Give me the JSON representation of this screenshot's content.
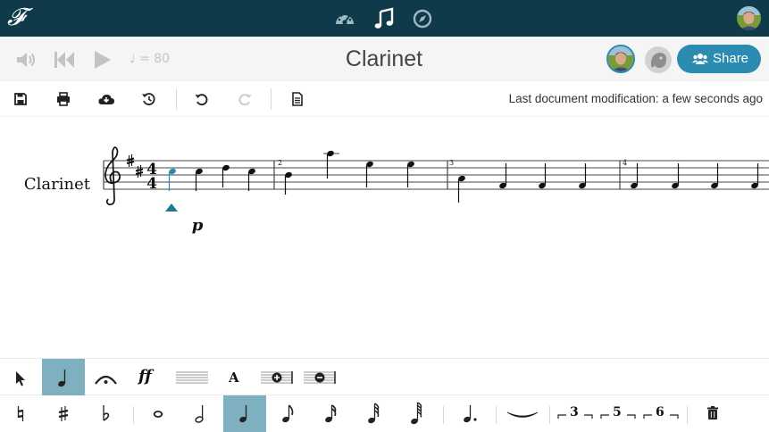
{
  "app": {
    "logo_text": "𝓕",
    "logo_icon": "flat-logo-icon"
  },
  "topnav": {
    "items": [
      {
        "name": "dashboard-icon",
        "active": false
      },
      {
        "name": "music-note-icon",
        "active": true
      },
      {
        "name": "compass-icon",
        "active": false
      }
    ]
  },
  "playback": {
    "tempo": "♩ = 80"
  },
  "document": {
    "title": "Clarinet",
    "last_modified": "Last document modification: a few seconds ago"
  },
  "share": {
    "label": "Share"
  },
  "score": {
    "instrument": "Clarinet",
    "dynamic": "p",
    "measure_numbers": [
      "2",
      "3",
      "4"
    ],
    "time_signature": [
      "4",
      "4"
    ]
  },
  "palette": {
    "dynamic_label": "ff",
    "text_label": "A",
    "tuplets": [
      "3",
      "5",
      "6"
    ]
  },
  "colors": {
    "topbar": "#0f3a4a",
    "accent": "#2b8bb0",
    "active_tool": "#7fb0c0",
    "cursor": "#1c7b8c"
  }
}
